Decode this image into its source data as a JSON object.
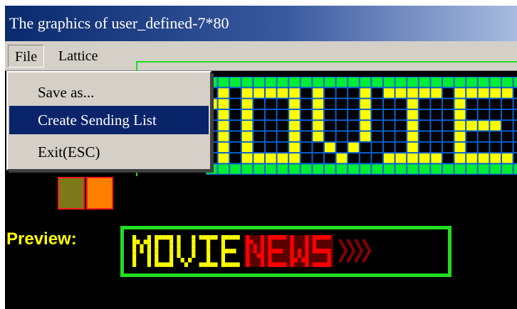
{
  "window": {
    "title": "The graphics of user_defined-7*80"
  },
  "menubar": {
    "file": "File",
    "lattice": "Lattice"
  },
  "file_menu": {
    "items": [
      "Save as...",
      "Create Sending List",
      "Exit(ESC)"
    ],
    "highlighted_index": 1
  },
  "preview": {
    "label": "Preview:",
    "text": "MOVIE NEWS"
  },
  "colors": {
    "lattice_on": "#ffff00",
    "lattice_off": "#000000",
    "lattice_border_cell": "#00ee33",
    "lattice_grid": "#0a5fd0",
    "swatch_1": "#7c7a18",
    "swatch_2": "#ff8000",
    "preview_border": "#22dd22",
    "preview_word1": "#ffff00",
    "preview_word2": "#ff0000",
    "preview_arrows": "#8b0000"
  },
  "lattice": {
    "visible_text": "MOVIE"
  }
}
